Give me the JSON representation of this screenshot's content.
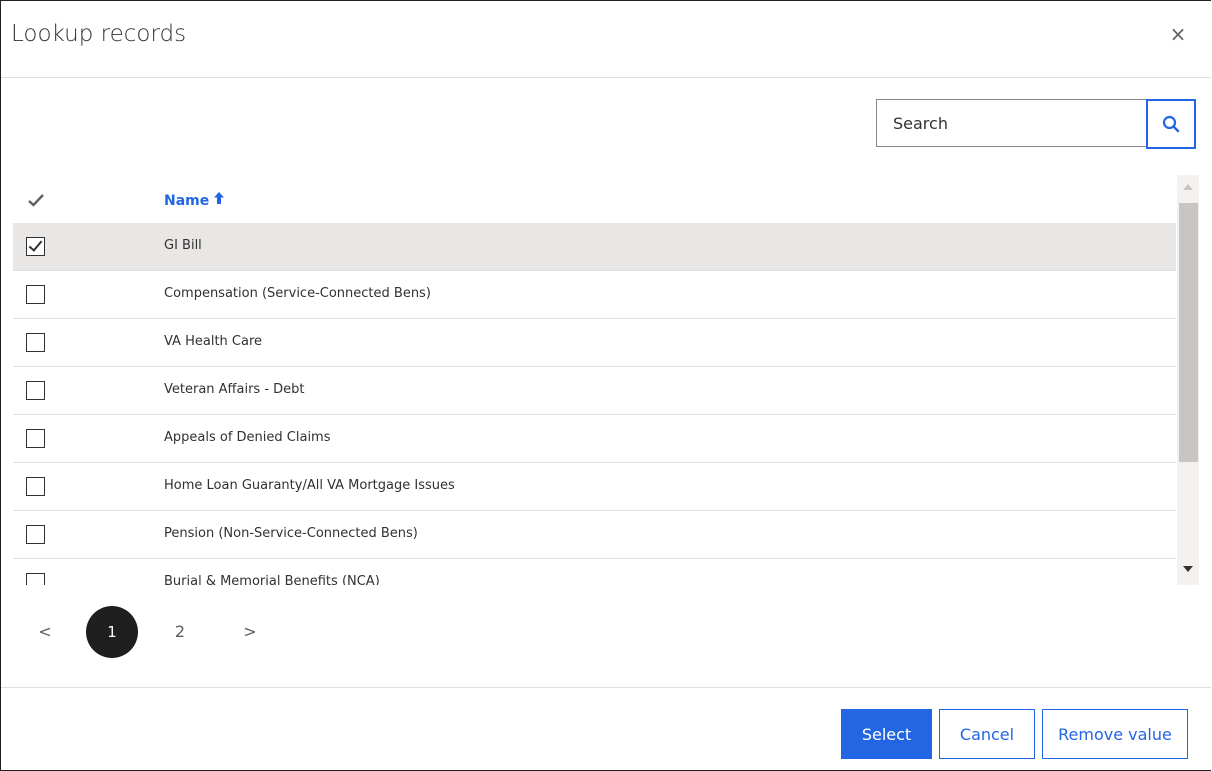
{
  "dialog": {
    "title": "Lookup records",
    "close_glyph": "×"
  },
  "search": {
    "placeholder": "Search",
    "icon": "search-icon"
  },
  "grid": {
    "columns": [
      {
        "label": "Name",
        "sorted": "ascending",
        "sort_glyph": "🠕"
      }
    ],
    "rows": [
      {
        "name": "GI Bill",
        "checked": true
      },
      {
        "name": "Compensation (Service-Connected Bens)",
        "checked": false
      },
      {
        "name": "VA Health Care",
        "checked": false
      },
      {
        "name": "Veteran Affairs - Debt",
        "checked": false
      },
      {
        "name": "Appeals of Denied Claims",
        "checked": false
      },
      {
        "name": "Home Loan Guaranty/All VA Mortgage Issues",
        "checked": false
      },
      {
        "name": "Pension (Non-Service-Connected Bens)",
        "checked": false
      },
      {
        "name": "Burial & Memorial Benefits (NCA)",
        "checked": false
      }
    ]
  },
  "pagination": {
    "prev": "<",
    "current": "1",
    "other_page": "2",
    "next": ">"
  },
  "footer": {
    "select_label": "Select",
    "cancel_label": "Cancel",
    "remove_label": "Remove value"
  },
  "colors": {
    "accent": "#2266e3",
    "selected_row": "#e8e7e6",
    "active_page": "#1f1f1f"
  }
}
